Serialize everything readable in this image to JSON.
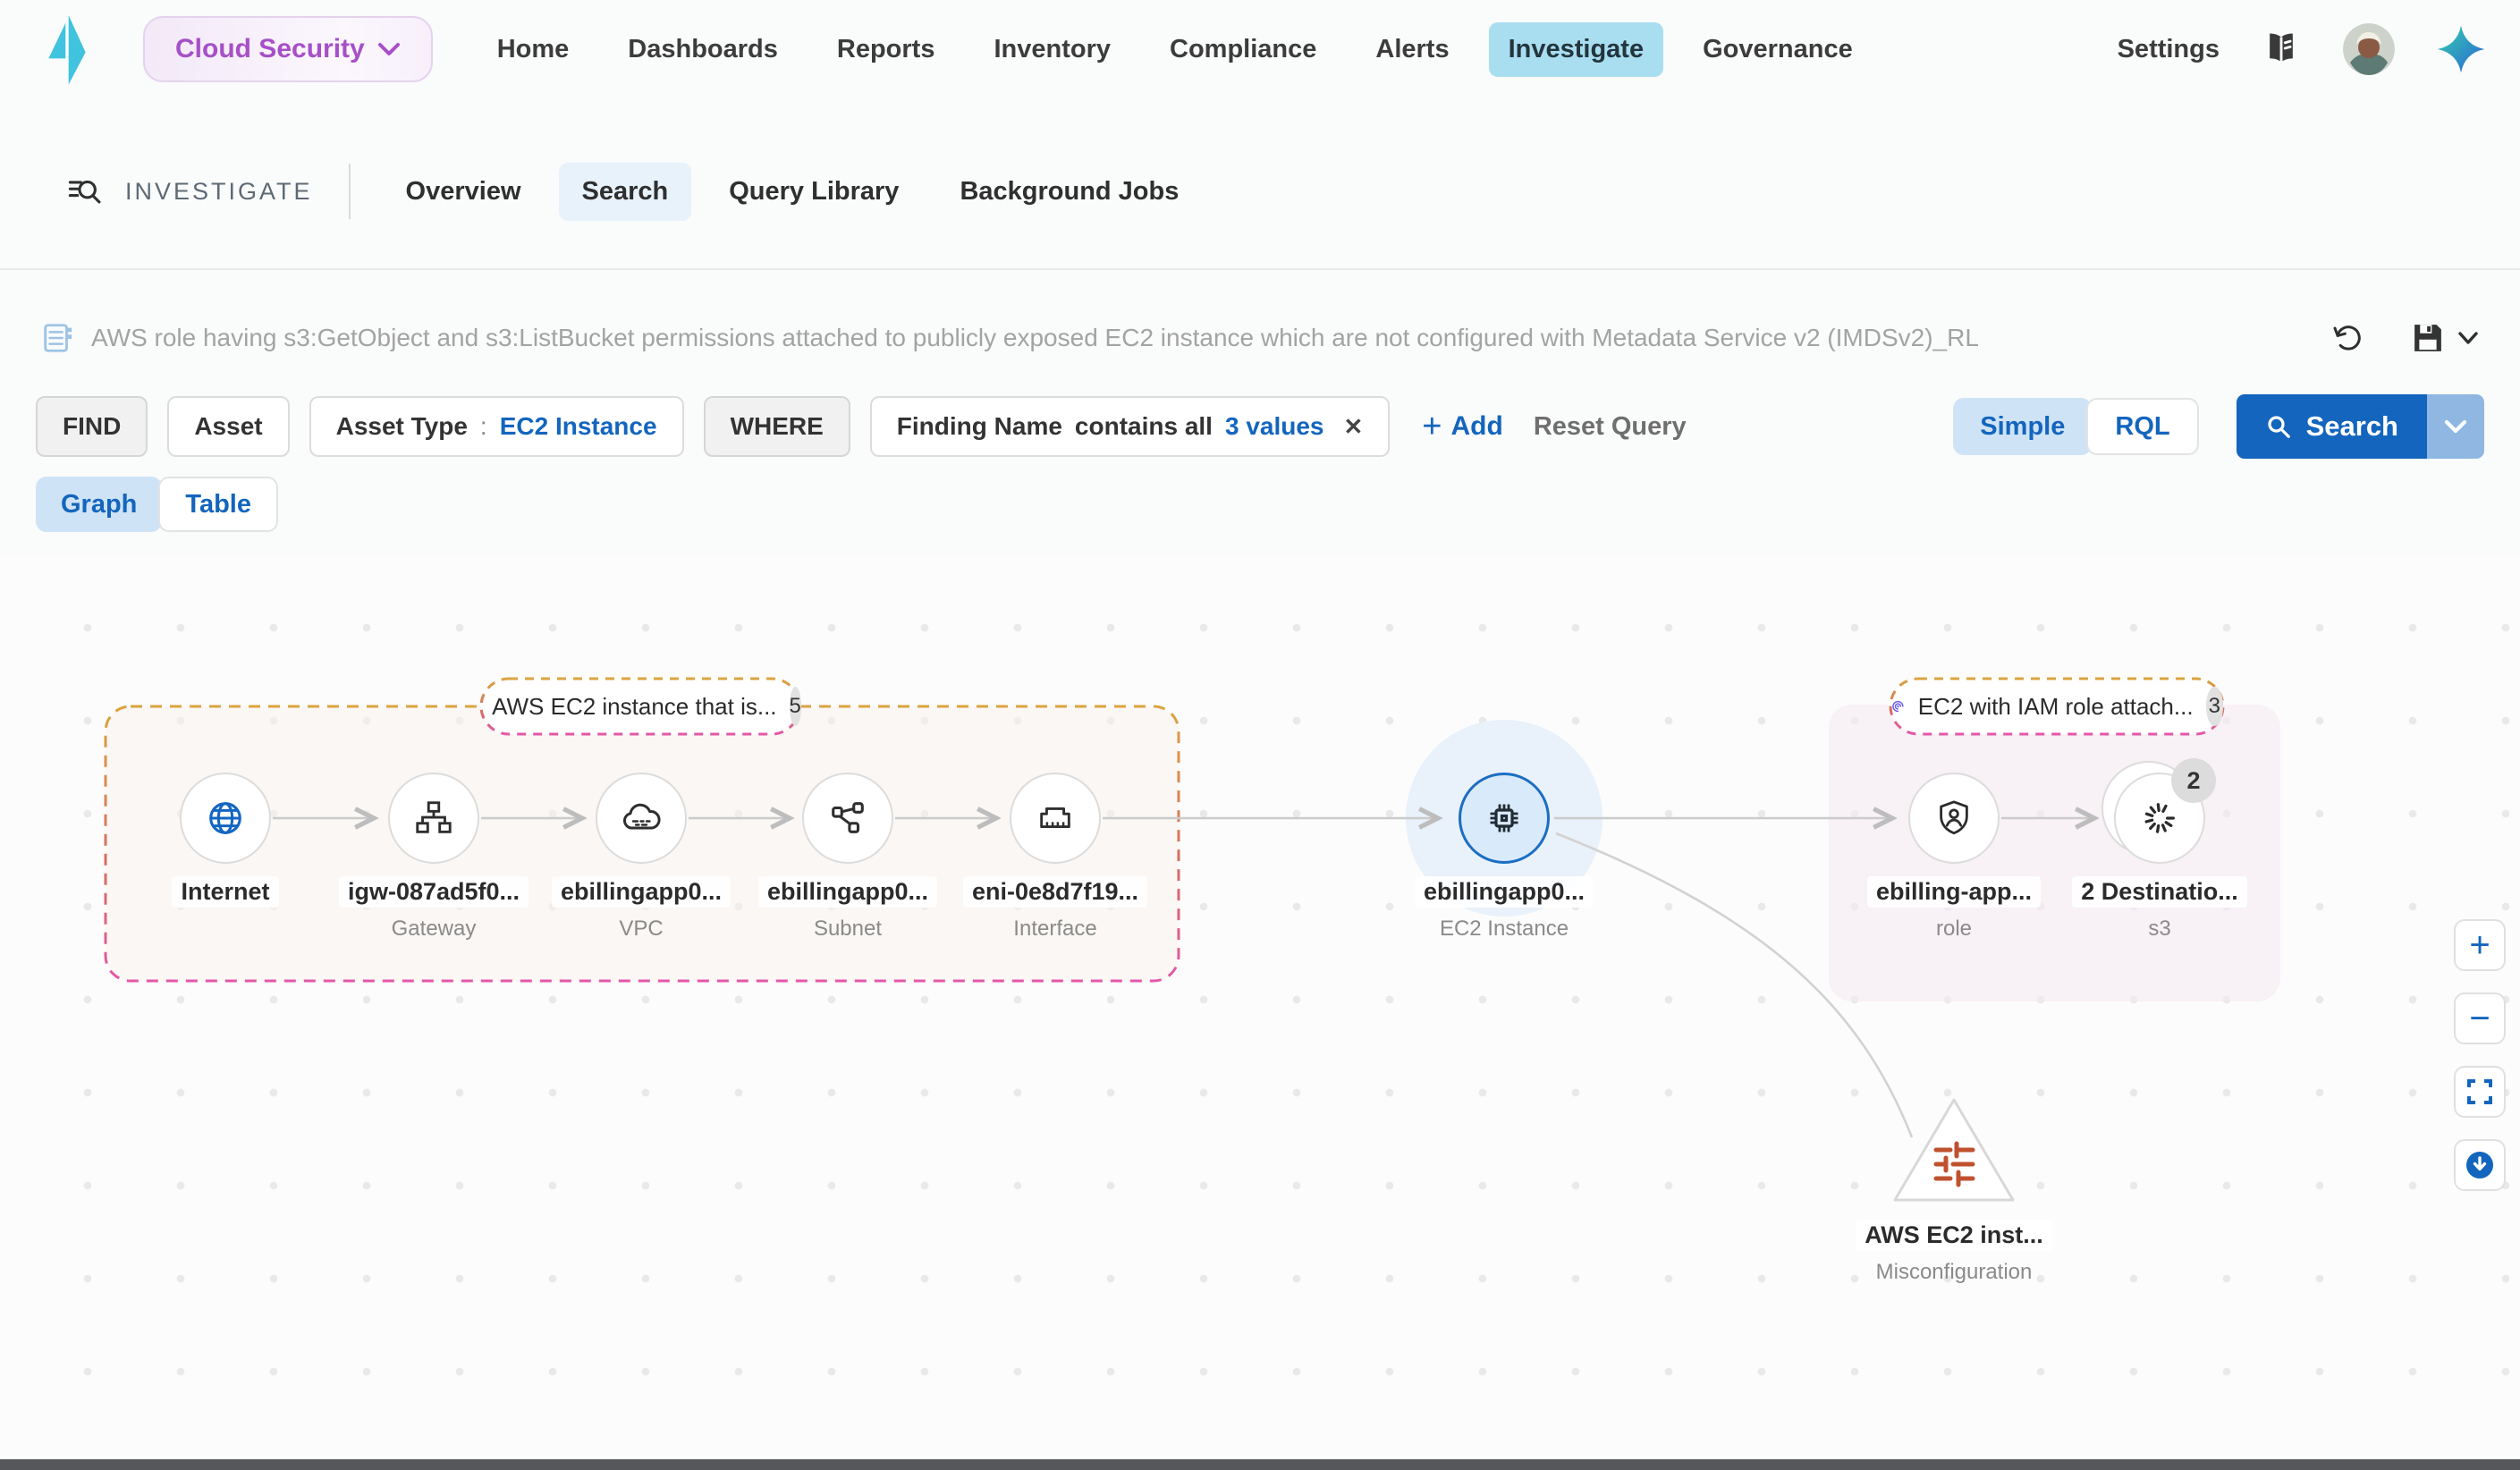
{
  "topnav": {
    "product": "Cloud Security",
    "items": [
      "Home",
      "Dashboards",
      "Reports",
      "Inventory",
      "Compliance",
      "Alerts",
      "Investigate",
      "Governance"
    ],
    "active_item": "Investigate",
    "settings": "Settings"
  },
  "subnav": {
    "section": "INVESTIGATE",
    "tabs": [
      "Overview",
      "Search",
      "Query Library",
      "Background Jobs"
    ],
    "active_tab": "Search"
  },
  "queryrow": {
    "saved_query": "AWS role having s3:GetObject and s3:ListBucket permissions attached to publicly exposed EC2 instance which are not configured with Metadata Service v2 (IMDSv2)_RL"
  },
  "builder": {
    "find": "FIND",
    "asset": "Asset",
    "asset_type": "Asset Type",
    "colon": ":",
    "asset_type_value": "EC2 Instance",
    "where": "WHERE",
    "field": "Finding Name",
    "operator": "contains all",
    "values": "3 values",
    "close_glyph": "✕",
    "add_glyph": "+",
    "add": "Add",
    "reset": "Reset Query",
    "simple": "Simple",
    "rql": "RQL",
    "search": "Search"
  },
  "viewtabs": {
    "graph": "Graph",
    "table": "Table"
  },
  "graph": {
    "group_left": {
      "label": "AWS EC2 instance that is...",
      "count": "5"
    },
    "group_right": {
      "label": "EC2 with IAM role attach...",
      "count": "3"
    },
    "nodes": [
      {
        "name": "Internet",
        "type": ""
      },
      {
        "name": "igw-087ad5f0...",
        "type": "Gateway"
      },
      {
        "name": "ebillingapp0...",
        "type": "VPC"
      },
      {
        "name": "ebillingapp0...",
        "type": "Subnet"
      },
      {
        "name": "eni-0e8d7f19...",
        "type": "Interface"
      },
      {
        "name": "ebillingapp0...",
        "type": "EC2 Instance"
      },
      {
        "name": "ebilling-app...",
        "type": "role"
      },
      {
        "name": "2 Destinatio...",
        "type": "s3",
        "badge": "2"
      },
      {
        "name": "AWS EC2 inst...",
        "type": "Misconfiguration"
      }
    ]
  },
  "controls": {
    "zoom_in": "+",
    "zoom_out": "−"
  },
  "colors": {
    "accent_blue": "#1365bd",
    "segment_blue": "#cfe3f6",
    "active_cyan": "#a9def1",
    "brand_purple": "#a74fc8",
    "dash_orange": "#dca43f",
    "dash_pink": "#e357a8",
    "misconfig_orange": "#c0512f",
    "edge_gray": "#cbcbcb",
    "selected_node_blue": "#1b6ec2"
  }
}
